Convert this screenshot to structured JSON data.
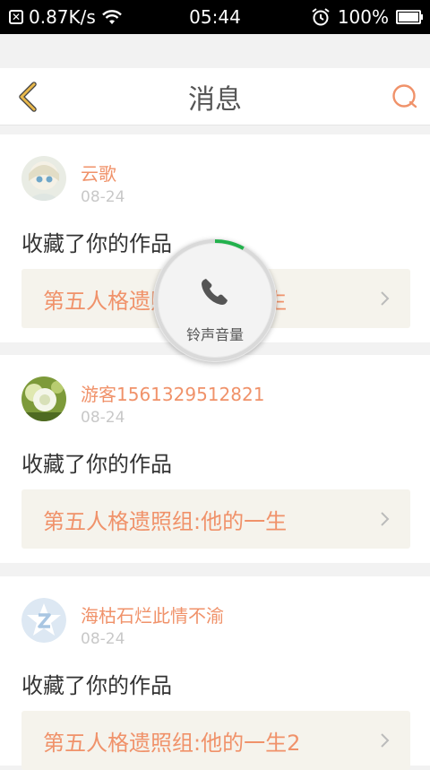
{
  "status_bar": {
    "speed": "0.87K/s",
    "time": "05:44",
    "battery": "100%",
    "battery_level": 1.0
  },
  "nav": {
    "title": "消息"
  },
  "messages": [
    {
      "user": "云歌",
      "date": "08-24",
      "action": "收藏了你的作品",
      "work": "第五人格遗照组:他的一生"
    },
    {
      "user": "游客1561329512821",
      "date": "08-24",
      "action": "收藏了你的作品",
      "work": "第五人格遗照组:他的一生"
    },
    {
      "user": "海枯石烂此情不渝",
      "date": "08-24",
      "action": "收藏了你的作品",
      "work": "第五人格遗照组:他的一生2"
    }
  ],
  "volume_overlay": {
    "label": "铃声音量",
    "level": 0.08
  },
  "colors": {
    "accent": "#f0926a",
    "back_icon": "#e8b84b",
    "volume_ring": "#22b14c"
  },
  "icons": {
    "back": "chevron-left-icon",
    "search": "search-icon",
    "phone": "phone-icon",
    "wifi": "wifi-icon",
    "alarm": "alarm-icon"
  }
}
